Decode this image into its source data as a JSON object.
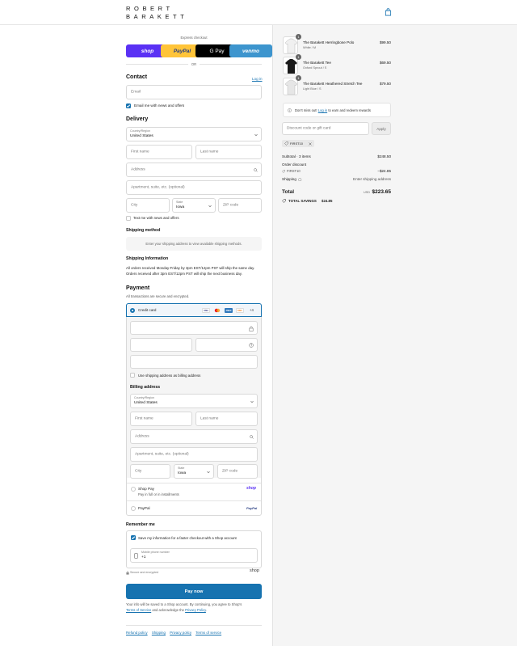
{
  "brand": {
    "line1": "ROBERT",
    "line2": "BARAKETT"
  },
  "express": {
    "title": "Express checkout",
    "or": "OR",
    "buttons": [
      {
        "label": "shop",
        "color": "#5a31f4"
      },
      {
        "label": "PayPal",
        "color": "#ffc439"
      },
      {
        "label": "G Pay",
        "color": "#000000"
      },
      {
        "label": "venmo",
        "color": "#3d95ce"
      }
    ]
  },
  "contact": {
    "title": "Contact",
    "login_link": "Log in",
    "email_placeholder": "Email",
    "newsletter_label": "Email me with news and offers",
    "newsletter_checked": true
  },
  "delivery": {
    "title": "Delivery",
    "country_label": "Country/Region",
    "country_value": "United States",
    "first_name": "First name",
    "last_name": "Last name",
    "address": "Address",
    "apartment": "Apartment, suite, etc. (optional)",
    "city": "City",
    "state_label": "State",
    "state_value": "Iowa",
    "zip": "ZIP code",
    "text_me": "Text me with news and offers"
  },
  "shipping_method": {
    "title": "Shipping method",
    "placeholder": "Enter your shipping address to view available shipping methods."
  },
  "shipping_info": {
    "title": "Shipping Information",
    "line1": "All orders received Monday-Friday by 3pm EST/12pm PST will ship the same day.",
    "line2": "Orders received after 3pm EST/12pm PST will ship the next business day."
  },
  "payment": {
    "title": "Payment",
    "subtitle": "All transactions are secure and encrypted.",
    "credit_card_label": "Credit card",
    "card_brands": [
      "VISA",
      "MC",
      "AMEX",
      "DISC"
    ],
    "more_cards": "+4",
    "use_shipping": "Use shipping address as billing address",
    "billing_title": "Billing address",
    "shop_pay_label": "Shop Pay",
    "shop_pay_sub": "Pay in full or in installments",
    "shop_pay_logo": "shop",
    "paypal_label": "PayPal",
    "paypal_logo": "PayPal"
  },
  "remember": {
    "title": "Remember me",
    "save_label": "Save my information for a faster checkout with a Shop account",
    "phone_label": "Mobile phone number",
    "phone_value": "+1",
    "secure": "Secure and encrypted",
    "shop_logo": "shop"
  },
  "pay_button": "Pay now",
  "legal": {
    "line1": "Your info will be saved to a Shop account. By continuing, you agree to Shop's",
    "terms": "Terms of Service",
    "and": "and acknowledge the",
    "privacy": "Privacy Policy",
    "end": "."
  },
  "footer_links": [
    "Refund policy",
    "Shipping",
    "Privacy policy",
    "Terms of service"
  ],
  "cart": {
    "items": [
      {
        "name": "The Barakett Herringbone Polo",
        "variant": "White / M",
        "price": "$99.50",
        "qty": "1",
        "shirt_color": "#f2f2f2"
      },
      {
        "name": "The Barakett Tee",
        "variant": "Oxford Sprout / S",
        "price": "$69.50",
        "qty": "1",
        "shirt_color": "#9a9a9a"
      },
      {
        "name": "The Barakett Heathered Stretch Tee",
        "variant": "Light Blue / S",
        "price": "$79.50",
        "qty": "1",
        "shirt_color": "#e8e8e8"
      }
    ],
    "rewards": {
      "pre": "Don't miss out!",
      "link": "Log in",
      "post": "to earn and redeem rewards"
    },
    "discount_placeholder": "Discount code or gift card",
    "apply": "Apply",
    "applied_code": "FIRST10",
    "subtotal_label": "Subtotal · 3 items",
    "subtotal": "$248.50",
    "order_discount_label": "Order discount",
    "discount_code": "FIRST10",
    "discount_value": "−$24.85",
    "shipping_label": "Shipping",
    "shipping_value": "Enter shipping address",
    "total_label": "Total",
    "currency": "USD",
    "total": "$223.65",
    "savings_label": "TOTAL SAVINGS",
    "savings": "$24.85"
  },
  "colors": {
    "accent": "#1773b0",
    "pay_button": "#1773b0"
  }
}
